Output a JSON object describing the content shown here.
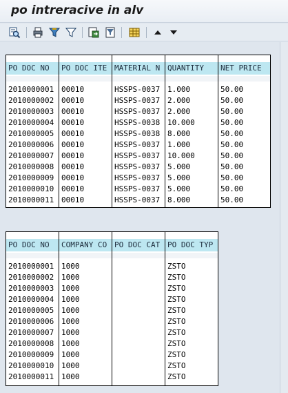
{
  "window": {
    "title": "po intreracive in alv"
  },
  "toolbar": {
    "icons": [
      "details-icon",
      "print-icon",
      "set-filter-icon",
      "delete-filter-icon",
      "export-icon",
      "print-preview-icon",
      "layout-grid-icon",
      "arrow-up-icon",
      "arrow-down-icon"
    ]
  },
  "grid1": {
    "headers": [
      "PO DOC NO",
      "PO DOC ITE",
      "MATERIAL N",
      "QUANTITY",
      "NET PRICE"
    ],
    "rows": [
      [
        "2010000001",
        "00010",
        "HSSPS-0037",
        "1.000",
        "50.00"
      ],
      [
        "2010000002",
        "00010",
        "HSSPS-0037",
        "2.000",
        "50.00"
      ],
      [
        "2010000003",
        "00010",
        "HSSPS-0037",
        "2.000",
        "50.00"
      ],
      [
        "2010000004",
        "00010",
        "HSSPS-0038",
        "10.000",
        "50.00"
      ],
      [
        "2010000005",
        "00010",
        "HSSPS-0038",
        "8.000",
        "50.00"
      ],
      [
        "2010000006",
        "00010",
        "HSSPS-0037",
        "1.000",
        "50.00"
      ],
      [
        "2010000007",
        "00010",
        "HSSPS-0037",
        "10.000",
        "50.00"
      ],
      [
        "2010000008",
        "00010",
        "HSSPS-0037",
        "5.000",
        "50.00"
      ],
      [
        "2010000009",
        "00010",
        "HSSPS-0037",
        "5.000",
        "50.00"
      ],
      [
        "2010000010",
        "00010",
        "HSSPS-0037",
        "5.000",
        "50.00"
      ],
      [
        "2010000011",
        "00010",
        "HSSPS-0037",
        "8.000",
        "50.00"
      ]
    ]
  },
  "grid2": {
    "headers": [
      "PO DOC NO",
      "COMPANY CO",
      "PO DOC CAT",
      "PO DOC TYP"
    ],
    "rows": [
      [
        "2010000001",
        "1000",
        "",
        "ZSTO"
      ],
      [
        "2010000002",
        "1000",
        "",
        "ZSTO"
      ],
      [
        "2010000003",
        "1000",
        "",
        "ZSTO"
      ],
      [
        "2010000004",
        "1000",
        "",
        "ZSTO"
      ],
      [
        "2010000005",
        "1000",
        "",
        "ZSTO"
      ],
      [
        "2010000006",
        "1000",
        "",
        "ZSTO"
      ],
      [
        "2010000007",
        "1000",
        "",
        "ZSTO"
      ],
      [
        "2010000008",
        "1000",
        "",
        "ZSTO"
      ],
      [
        "2010000009",
        "1000",
        "",
        "ZSTO"
      ],
      [
        "2010000010",
        "1000",
        "",
        "ZSTO"
      ],
      [
        "2010000011",
        "1000",
        "",
        "ZSTO"
      ]
    ]
  },
  "colors": {
    "header_bg": "#bde7f1",
    "grid_border": "#000000",
    "background": "#dfe6ee"
  }
}
